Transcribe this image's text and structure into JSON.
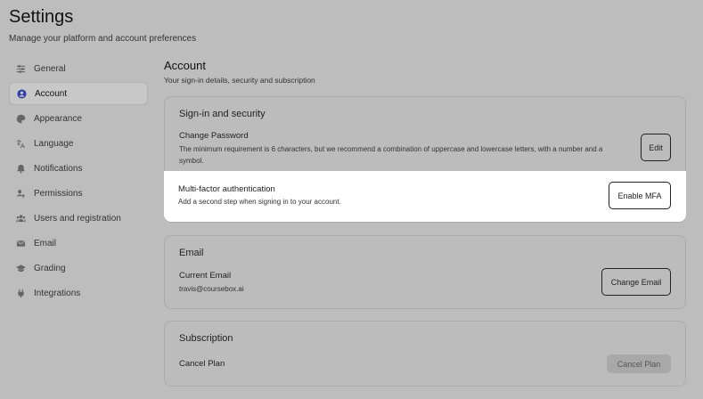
{
  "header": {
    "title": "Settings",
    "subtitle": "Manage your platform and account preferences"
  },
  "sidebar": {
    "items": [
      {
        "label": "General",
        "icon": "sliders-icon"
      },
      {
        "label": "Account",
        "icon": "user-circle-icon",
        "active": true
      },
      {
        "label": "Appearance",
        "icon": "palette-icon"
      },
      {
        "label": "Language",
        "icon": "translate-icon"
      },
      {
        "label": "Notifications",
        "icon": "bell-icon"
      },
      {
        "label": "Permissions",
        "icon": "user-key-icon"
      },
      {
        "label": "Users and registration",
        "icon": "users-icon"
      },
      {
        "label": "Email",
        "icon": "envelope-icon"
      },
      {
        "label": "Grading",
        "icon": "graduation-cap-icon"
      },
      {
        "label": "Integrations",
        "icon": "plug-icon"
      }
    ]
  },
  "main": {
    "title": "Account",
    "subtitle": "Your sign-in details, security and subscription"
  },
  "security_card": {
    "title": "Sign-in and security",
    "password": {
      "title": "Change Password",
      "description": "The minimum requirement is 6 characters, but we recommend a combination of uppercase and lowercase letters, with a number and a symbol.",
      "button": "Edit"
    },
    "mfa": {
      "title": "Multi-factor authentication",
      "description": "Add a second step when signing in to your account.",
      "button": "Enable MFA"
    }
  },
  "email_card": {
    "title": "Email",
    "current_title": "Current Email",
    "current_value": "travis@coursebox.ai",
    "button": "Change Email"
  },
  "subscription_card": {
    "title": "Subscription",
    "cancel_title": "Cancel Plan",
    "button": "Cancel Plan"
  },
  "colors": {
    "overlay": "#bdbdbd",
    "highlight": "#ffffff",
    "active_icon": "#2b3eaa"
  }
}
